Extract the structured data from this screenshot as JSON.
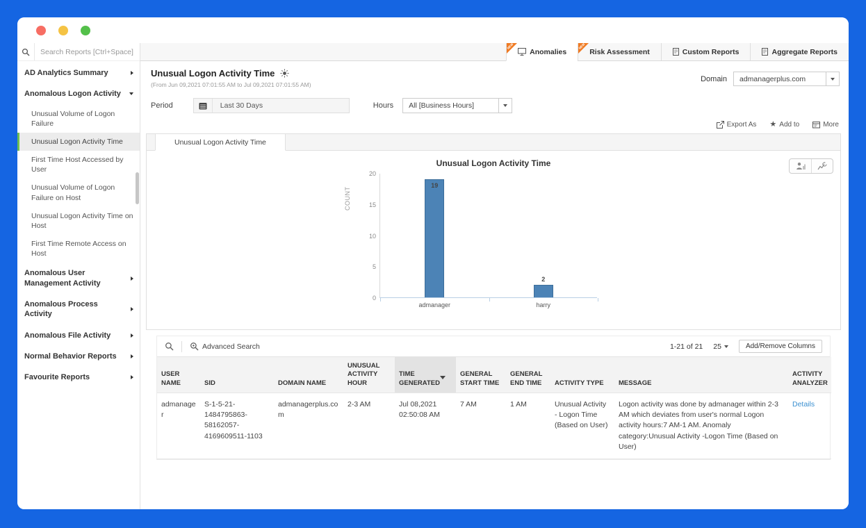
{
  "window": {
    "controls": [
      "close",
      "minimize",
      "zoom"
    ]
  },
  "sidebar": {
    "search_placeholder": "Search Reports [Ctrl+Space]",
    "items": [
      {
        "label": "AD Analytics Summary",
        "level": 1,
        "expanded": false,
        "active": false
      },
      {
        "label": "Anomalous Logon Activity",
        "level": 1,
        "expanded": true,
        "active": false
      },
      {
        "label": "Unusual Volume of Logon Failure",
        "level": 2,
        "active": false
      },
      {
        "label": "Unusual Logon Activity Time",
        "level": 2,
        "active": true
      },
      {
        "label": "First Time Host Accessed by User",
        "level": 2,
        "active": false
      },
      {
        "label": "Unusual Volume of Logon Failure on Host",
        "level": 2,
        "active": false
      },
      {
        "label": "Unusual Logon Activity Time on Host",
        "level": 2,
        "active": false
      },
      {
        "label": "First Time Remote Access on Host",
        "level": 2,
        "active": false
      },
      {
        "label": "Anomalous User Management Activity",
        "level": 1,
        "expanded": false,
        "active": false
      },
      {
        "label": "Anomalous Process Activity",
        "level": 1,
        "expanded": false,
        "active": false
      },
      {
        "label": "Anomalous File Activity",
        "level": 1,
        "expanded": false,
        "active": false
      },
      {
        "label": "Normal Behavior Reports",
        "level": 1,
        "expanded": false,
        "active": false
      },
      {
        "label": "Favourite Reports",
        "level": 1,
        "expanded": false,
        "active": false
      }
    ]
  },
  "top_tabs": [
    {
      "label": "Anomalies",
      "badge": "NEW",
      "active": true
    },
    {
      "label": "Risk Assessment",
      "badge": "NEW",
      "active": false
    },
    {
      "label": "Custom Reports",
      "badge": "",
      "active": false
    },
    {
      "label": "Aggregate Reports",
      "badge": "",
      "active": false
    }
  ],
  "header": {
    "title": "Unusual Logon Activity Time",
    "subtitle": "(From Jun 09,2021 07:01:55 AM to Jul 09,2021 07:01:55 AM)",
    "domain_label": "Domain",
    "domain_value": "admanagerplus.com"
  },
  "filters": {
    "period_label": "Period",
    "period_value": "Last 30 Days",
    "hours_label": "Hours",
    "hours_value": "All [Business Hours]"
  },
  "actions": {
    "export_label": "Export As",
    "add_to_label": "Add to",
    "more_label": "More"
  },
  "report": {
    "tab_label": "Unusual Logon Activity Time"
  },
  "chart_data": {
    "type": "bar",
    "title": "Unusual Logon Activity Time",
    "categories": [
      "admanager",
      "harry"
    ],
    "values": [
      19,
      2
    ],
    "xlabel": "",
    "ylabel": "COUNT",
    "ylim": [
      0,
      20
    ],
    "yticks": [
      0,
      5,
      10,
      15,
      20
    ],
    "bar_color": "#4c83b6",
    "bar_border_color": "#3c6d99",
    "grid": false,
    "legend": false
  },
  "table": {
    "advanced_search_label": "Advanced Search",
    "pagination": "1-21 of 21",
    "page_size": "25",
    "add_remove_columns_label": "Add/Remove Columns",
    "columns": [
      "USER NAME",
      "SID",
      "DOMAIN NAME",
      "UNUSUAL ACTIVITY HOUR",
      "TIME GENERATED",
      "GENERAL START TIME",
      "GENERAL END TIME",
      "ACTIVITY TYPE",
      "MESSAGE",
      "ACTIVITY ANALYZER"
    ],
    "sorted_column": "TIME GENERATED",
    "rows": [
      {
        "user_name": "admanager",
        "sid": "S-1-5-21-1484795863-58162057-4169609511-1103",
        "domain_name": "admanagerplus.com",
        "unusual_activity_hour": "2-3 AM",
        "time_generated": "Jul 08,2021 02:50:08 AM",
        "general_start_time": "7 AM",
        "general_end_time": "1 AM",
        "activity_type": "Unusual Activity - Logon Time (Based on User)",
        "message": "Logon activity was done by admanager within 2-3 AM which deviates from user's normal Logon activity hours:7 AM-1 AM. Anomaly category:Unusual Activity -Logon Time (Based on User)",
        "activity_analyzer": "Details"
      }
    ]
  }
}
